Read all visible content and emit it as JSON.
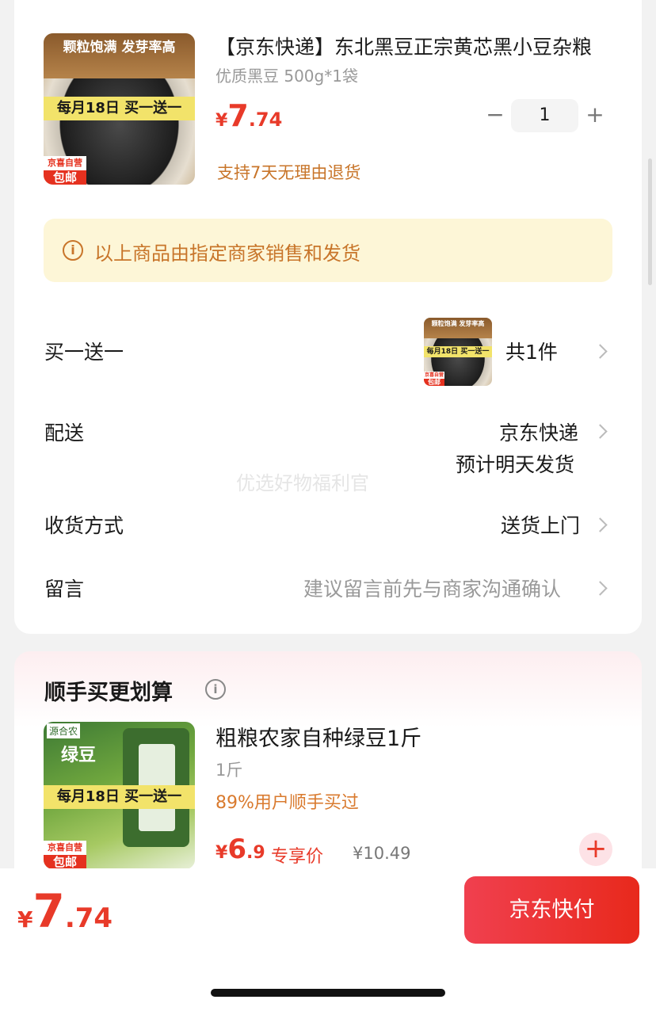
{
  "product": {
    "title": "【京东快递】东北黑豆正宗黄芯黑小豆杂粮",
    "spec": "优质黑豆 500g*1袋",
    "price": {
      "currency": "¥",
      "integer": "7",
      "decimal": ".74"
    },
    "return_policy": "支持7天无理由退货",
    "quantity": "1",
    "qty_minus": "−",
    "qty_plus": "+",
    "image_text": {
      "top": "颗粒饱满 发芽率高",
      "promo": "每月18日 买一送一",
      "badge_top": "京喜自营",
      "badge_bottom": "包邮"
    }
  },
  "notice": {
    "icon": "i",
    "text": "以上商品由指定商家销售和发货"
  },
  "rows": {
    "gift": {
      "label": "买一送一",
      "value": "共1件"
    },
    "delivery": {
      "label": "配送",
      "value": "京东快递",
      "sub": "预计明天发货"
    },
    "receive": {
      "label": "收货方式",
      "value": "送货上门"
    },
    "message": {
      "label": "留言",
      "placeholder": "建议留言前先与商家沟通确认"
    }
  },
  "watermark": "优选好物福利官",
  "upsell": {
    "title": "顺手买更划算",
    "info_icon": "i",
    "item": {
      "title": "粗粮农家自种绿豆1斤",
      "spec": "1斤",
      "social": "89%用户顺手买过",
      "price": {
        "currency": "¥",
        "integer": "6",
        "decimal": ".9"
      },
      "exclusive_label": "专享价",
      "original_price": "¥10.49",
      "add_symbol": "+",
      "image_text": {
        "brand": "源合农",
        "name": "绿豆",
        "promo": "每月18日 买一送一",
        "badge_top": "京喜自营",
        "badge_bottom": "包邮"
      }
    }
  },
  "bottom": {
    "total": {
      "currency": "¥",
      "integer": "7",
      "decimal": ".74"
    },
    "pay_button": "京东快付"
  },
  "colors": {
    "accent": "#e83a29",
    "notice_bg": "#fdf6d7",
    "notice_text": "#c8752a"
  }
}
